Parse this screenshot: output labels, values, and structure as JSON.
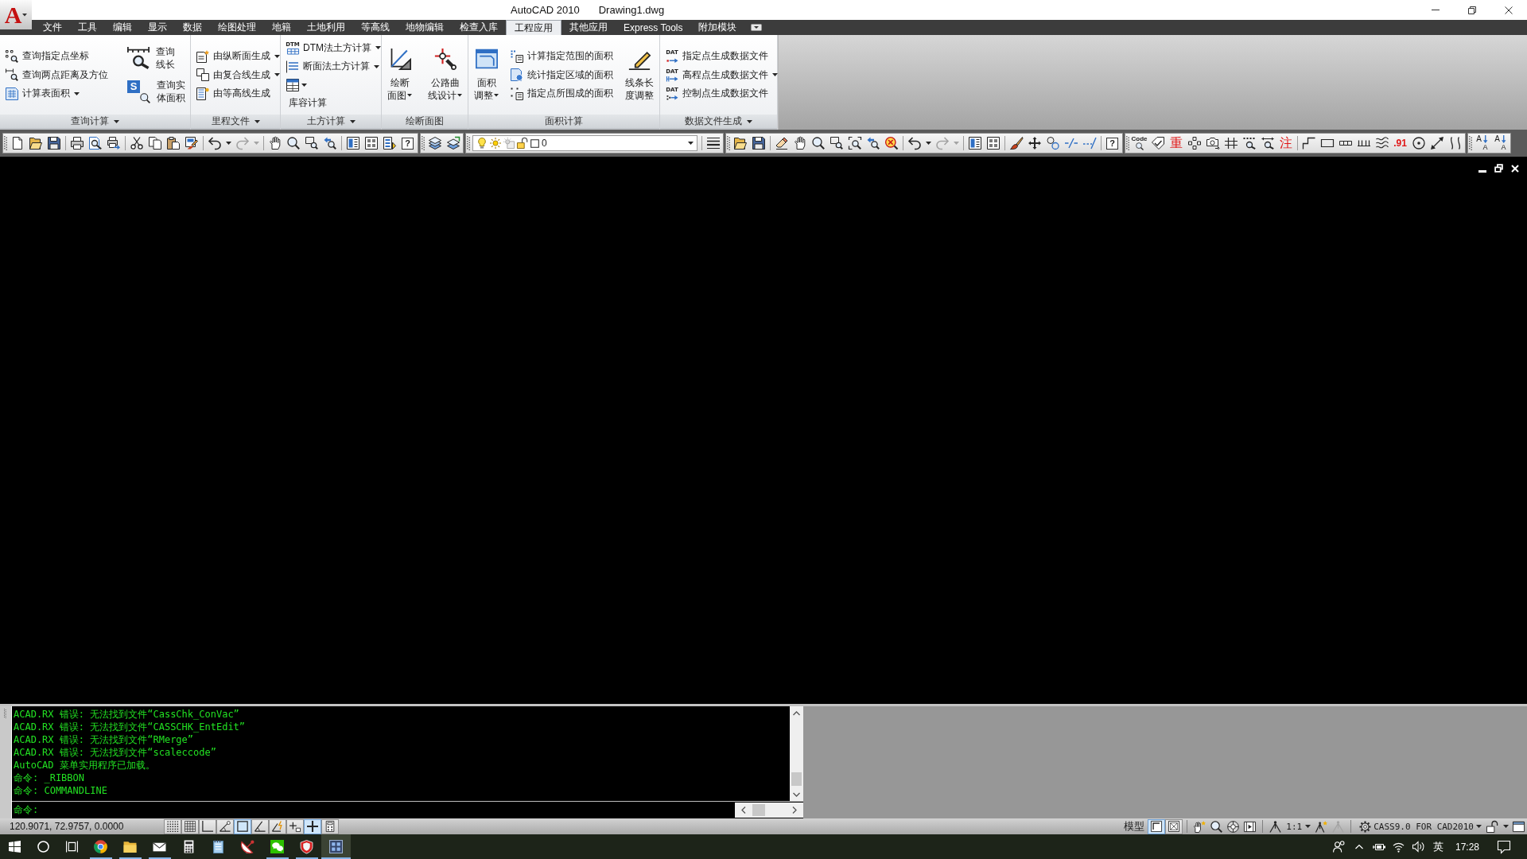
{
  "window": {
    "app_button": "A",
    "title": "AutoCAD 2010",
    "document": "Drawing1.dwg"
  },
  "menu_bar": [
    {
      "label": "文件",
      "selected": false
    },
    {
      "label": "工具",
      "selected": false
    },
    {
      "label": "编辑",
      "selected": false
    },
    {
      "label": "显示",
      "selected": false
    },
    {
      "label": "数据",
      "selected": false
    },
    {
      "label": "绘图处理",
      "selected": false
    },
    {
      "label": "地籍",
      "selected": false
    },
    {
      "label": "土地利用",
      "selected": false
    },
    {
      "label": "等高线",
      "selected": false
    },
    {
      "label": "地物编辑",
      "selected": false
    },
    {
      "label": "检查入库",
      "selected": false
    },
    {
      "label": "工程应用",
      "selected": true
    },
    {
      "label": "其他应用",
      "selected": false
    },
    {
      "label": "Express Tools",
      "selected": false
    },
    {
      "label": "附加模块",
      "selected": false
    }
  ],
  "ribbon": {
    "panels": [
      {
        "title": "查询计算",
        "expandable": true,
        "columns": [
          [
            {
              "kind": "small",
              "label": "查询指定点坐标",
              "dropdown": false
            },
            {
              "kind": "small",
              "label": "查询两点距离及方位",
              "dropdown": false
            },
            {
              "kind": "small",
              "label": "计算表面积",
              "dropdown": true
            }
          ],
          [
            {
              "kind": "medium",
              "lines": [
                "查询",
                "线长"
              ],
              "dropdown": false
            },
            {
              "kind": "medium",
              "lines": [
                "查询实",
                "体面积"
              ],
              "dropdown": false,
              "icon_text": "S"
            }
          ]
        ]
      },
      {
        "title": "里程文件",
        "expandable": true,
        "columns": [
          [
            {
              "kind": "small",
              "label": "由纵断面生成",
              "dropdown": true
            },
            {
              "kind": "small",
              "label": "由复合线生成",
              "dropdown": true
            },
            {
              "kind": "small",
              "label": "由等高线生成",
              "dropdown": false
            }
          ]
        ]
      },
      {
        "title": "土方计算",
        "expandable": true,
        "columns": [
          [
            {
              "kind": "small",
              "label": "DTM法土方计算",
              "dropdown": true,
              "icon_text": "DTM"
            },
            {
              "kind": "small",
              "label": "断面法土方计算",
              "dropdown": true
            },
            {
              "kind": "icon",
              "dropdown": true
            },
            {
              "kind": "text",
              "label": "库容计算"
            }
          ]
        ]
      },
      {
        "title": "绘断面图",
        "expandable": false,
        "columns": [
          [
            {
              "kind": "large",
              "lines": [
                "绘断",
                "面图"
              ],
              "dropdown": true
            }
          ],
          [
            {
              "kind": "large",
              "lines": [
                "公路曲",
                "线设计"
              ],
              "dropdown": true
            }
          ]
        ]
      },
      {
        "title": "面积计算",
        "expandable": false,
        "columns": [
          [
            {
              "kind": "large",
              "lines": [
                "面积",
                "调整"
              ],
              "dropdown": true
            }
          ],
          [
            {
              "kind": "small",
              "label": "计算指定范围的面积",
              "dropdown": false
            },
            {
              "kind": "small",
              "label": "统计指定区域的面积",
              "dropdown": false
            },
            {
              "kind": "small",
              "label": "指定点所围成的面积",
              "dropdown": false
            }
          ],
          [
            {
              "kind": "large",
              "lines": [
                "线条长",
                "度调整"
              ],
              "dropdown": false
            }
          ]
        ]
      },
      {
        "title": "数据文件生成",
        "expandable": true,
        "columns": [
          [
            {
              "kind": "small",
              "label": "指定点生成数据文件",
              "dropdown": false,
              "icon_text": "DAT"
            },
            {
              "kind": "small",
              "label": "高程点生成数据文件",
              "dropdown": true,
              "icon_text": "DAT"
            },
            {
              "kind": "small",
              "label": "控制点生成数据文件",
              "dropdown": false,
              "icon_text": "DAT"
            }
          ]
        ]
      }
    ]
  },
  "toolbars": {
    "labels": [
      "?",
      "?",
      "Code",
      "重",
      "注",
      ".91"
    ],
    "layer_value": "0",
    "text_scale_buttons": [
      {
        "upper": "A",
        "lower": "A"
      },
      {
        "upper": "A",
        "lower": "A"
      }
    ]
  },
  "command_line": {
    "history": [
      "ACAD.RX 错误: 无法找到文件“CassChk_ConVac”",
      "ACAD.RX 错误: 无法找到文件“CASSCHK_EntEdit”",
      "ACAD.RX 错误: 无法找到文件“RMerge”",
      "ACAD.RX 错误: 无法找到文件“scaleccode”",
      "AutoCAD 菜单实用程序已加载。",
      "命令: _RIBBON",
      "命令: COMMANDLINE"
    ],
    "prompt": "命令:"
  },
  "status_bar": {
    "coordinates": "120.9071, 72.9757, 0.0000",
    "toggles": [
      {
        "on": false
      },
      {
        "on": false
      },
      {
        "on": false
      },
      {
        "on": false
      },
      {
        "on": true
      },
      {
        "on": false
      },
      {
        "on": false
      },
      {
        "on": false
      },
      {
        "on": true
      },
      {
        "on": false
      }
    ],
    "space": "模型",
    "layouts": [
      {
        "selected": true
      },
      {
        "selected": false
      }
    ],
    "annotation_scale": "1:1",
    "workspace": "CASS9.0 FOR CAD2010"
  },
  "taskbar": {
    "apps": [
      {
        "running": true,
        "active": false
      },
      {
        "running": true,
        "active": false
      },
      {
        "running": true,
        "active": false
      },
      {
        "running": false,
        "active": false
      },
      {
        "running": false,
        "active": false
      },
      {
        "running": false,
        "active": false
      },
      {
        "running": true,
        "active": false
      },
      {
        "running": true,
        "active": false
      },
      {
        "running": true,
        "active": true
      }
    ],
    "input_method": "英",
    "clock": "17:28"
  }
}
